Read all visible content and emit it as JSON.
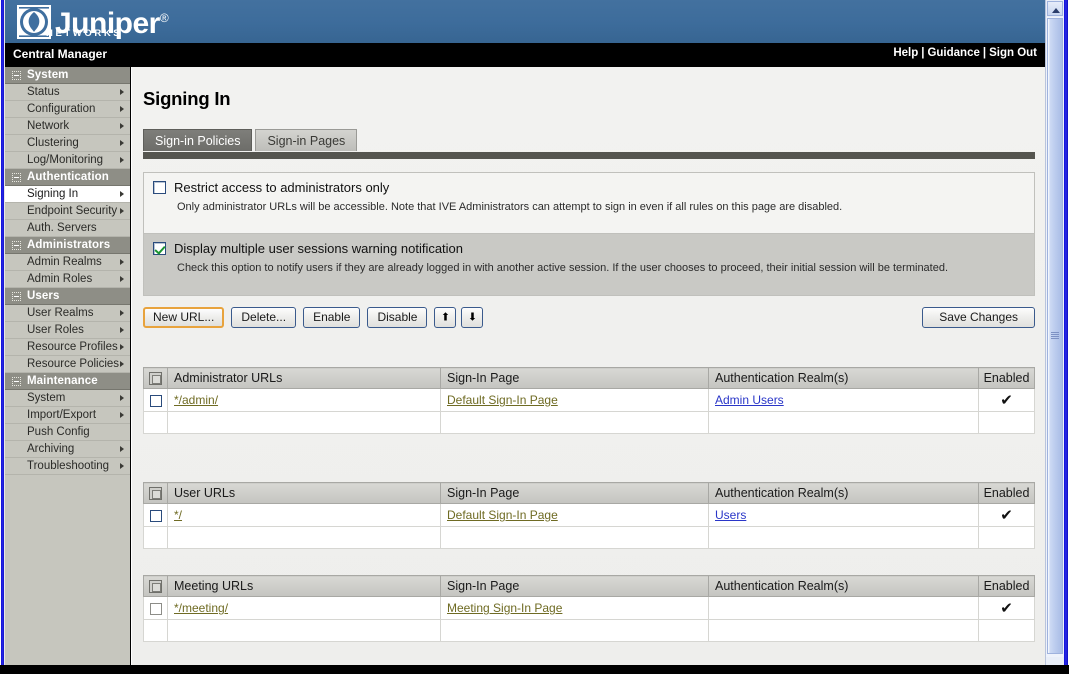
{
  "banner": {
    "brand": "Juniper",
    "brand_reg": "®",
    "brand_sub": "NETWORKS"
  },
  "topbar": {
    "app_title": "Central Manager",
    "links": [
      {
        "label": "Help"
      },
      {
        "label": "Guidance"
      },
      {
        "label": "Sign Out"
      }
    ],
    "separator": "|"
  },
  "sidebar": {
    "groups": [
      {
        "label": "System",
        "items": [
          {
            "label": "Status",
            "arrow": true
          },
          {
            "label": "Configuration",
            "arrow": true
          },
          {
            "label": "Network",
            "arrow": true
          },
          {
            "label": "Clustering",
            "arrow": true
          },
          {
            "label": "Log/Monitoring",
            "arrow": true
          }
        ]
      },
      {
        "label": "Authentication",
        "items": [
          {
            "label": "Signing In",
            "arrow": true,
            "selected": true
          },
          {
            "label": "Endpoint Security",
            "arrow": true
          },
          {
            "label": "Auth. Servers",
            "arrow": false
          }
        ]
      },
      {
        "label": "Administrators",
        "items": [
          {
            "label": "Admin Realms",
            "arrow": true
          },
          {
            "label": "Admin Roles",
            "arrow": true
          }
        ]
      },
      {
        "label": "Users",
        "items": [
          {
            "label": "User Realms",
            "arrow": true
          },
          {
            "label": "User Roles",
            "arrow": true
          },
          {
            "label": "Resource Profiles",
            "arrow": true
          },
          {
            "label": "Resource Policies",
            "arrow": true
          }
        ]
      },
      {
        "label": "Maintenance",
        "items": [
          {
            "label": "System",
            "arrow": true
          },
          {
            "label": "Import/Export",
            "arrow": true
          },
          {
            "label": "Push Config",
            "arrow": false
          },
          {
            "label": "Archiving",
            "arrow": true
          },
          {
            "label": "Troubleshooting",
            "arrow": true
          }
        ]
      }
    ]
  },
  "main": {
    "page_title": "Signing In",
    "tabs": [
      {
        "label": "Sign-in Policies",
        "active": true
      },
      {
        "label": "Sign-in Pages",
        "active": false
      }
    ],
    "options": [
      {
        "label": "Restrict access to administrators only",
        "description": "Only administrator URLs will be accessible. Note that IVE Administrators can attempt to sign in even if all rules on this page are disabled.",
        "checked": false
      },
      {
        "label": "Display multiple user sessions warning notification",
        "description": "Check this option to notify users if they are already logged in with another active session. If the user chooses to proceed, their initial session will be terminated.",
        "checked": true
      }
    ],
    "toolbar": {
      "new_url": "New URL...",
      "delete": "Delete...",
      "enable": "Enable",
      "disable": "Disable",
      "move_up_icon": "arrow-up-icon",
      "move_down_icon": "arrow-down-icon",
      "move_up_glyph": "⬆",
      "move_down_glyph": "⬇",
      "save_changes": "Save Changes"
    },
    "tables": [
      {
        "name": "administrator-urls",
        "headers": {
          "url": "Administrator URLs",
          "signin_page": "Sign-In Page",
          "realms": "Authentication Realm(s)",
          "enabled": "Enabled"
        },
        "rows": [
          {
            "url": "*/admin/",
            "signin_page": "Default Sign-In Page",
            "realms": "Admin Users",
            "enabled": "✔"
          }
        ]
      },
      {
        "name": "user-urls",
        "headers": {
          "url": "User URLs",
          "signin_page": "Sign-In Page",
          "realms": "Authentication Realm(s)",
          "enabled": "Enabled"
        },
        "rows": [
          {
            "url": "*/",
            "signin_page": "Default Sign-In Page",
            "realms": "Users",
            "enabled": "✔"
          }
        ]
      },
      {
        "name": "meeting-urls",
        "headers": {
          "url": "Meeting URLs",
          "signin_page": "Sign-In Page",
          "realms": "Authentication Realm(s)",
          "enabled": "Enabled"
        },
        "rows": [
          {
            "url": "*/meeting/",
            "signin_page": "Meeting Sign-In Page",
            "realms": "",
            "enabled": "✔"
          }
        ]
      }
    ]
  },
  "colors": {
    "banner_blue": "#3f6f9f",
    "sidebar_group": "#8e8e86",
    "sidebar_item": "#c6c6be",
    "tab_active": "#6d6d69",
    "link_olive": "#6f6b23",
    "link_blue": "#2a36c8",
    "focus_orange": "#e8a33d",
    "check_green": "#1a9431"
  }
}
